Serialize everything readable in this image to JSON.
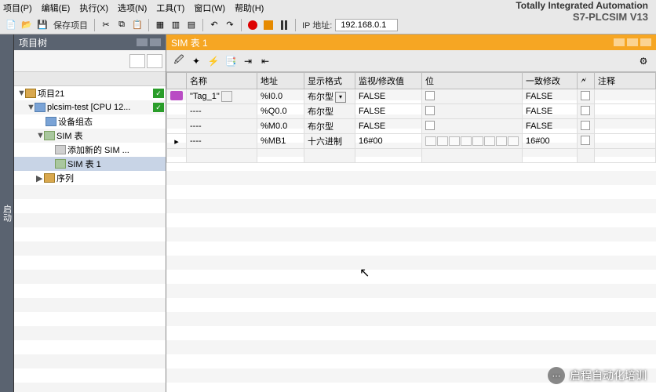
{
  "brand": {
    "line1": "Totally Integrated Automation",
    "line2": "S7-PLCSIM V13"
  },
  "menu": {
    "m0": "项目(P)",
    "m1": "编辑(E)",
    "m2": "执行(X)",
    "m3": "选项(N)",
    "m4": "工具(T)",
    "m5": "窗口(W)",
    "m6": "帮助(H)"
  },
  "toolbar": {
    "save": "保存项目",
    "ip_label": "IP 地址:",
    "ip_value": "192.168.0.1"
  },
  "side_tab": "启动",
  "tree": {
    "title": "项目树",
    "n0": "项目21",
    "n1": "plcsim-test [CPU 12...",
    "n2": "设备组态",
    "n3": "SIM 表",
    "n4": "添加新的 SIM ...",
    "n5": "SIM 表 1",
    "n6": "序列"
  },
  "main": {
    "title": "SIM 表 1"
  },
  "grid": {
    "h": {
      "name": "名称",
      "addr": "地址",
      "fmt": "显示格式",
      "mon": "监视/修改值",
      "bit": "位",
      "mod": "一致修改",
      "flash": "🗲",
      "comment": "注释"
    },
    "r0": {
      "name": "\"Tag_1\"",
      "addr": "%I0.0",
      "fmt": "布尔型",
      "mon": "FALSE",
      "mod": "FALSE"
    },
    "r1": {
      "name": "----",
      "addr": "%Q0.0",
      "fmt": "布尔型",
      "mon": "FALSE",
      "mod": "FALSE"
    },
    "r2": {
      "name": "----",
      "addr": "%M0.0",
      "fmt": "布尔型",
      "mon": "FALSE",
      "mod": "FALSE"
    },
    "r3": {
      "name": "----",
      "addr": "%MB1",
      "fmt": "十六进制",
      "mon": "16#00",
      "mod": "16#00"
    }
  },
  "watermark": "启程自动化培训"
}
